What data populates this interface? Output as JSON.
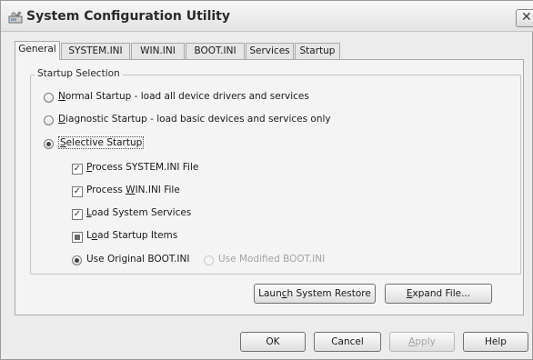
{
  "window": {
    "title": "System Configuration Utility",
    "app_icon": "system-config-icon",
    "close_glyph": "✕"
  },
  "tabs": [
    {
      "label": "General",
      "active": true
    },
    {
      "label": "SYSTEM.INI",
      "active": false
    },
    {
      "label": "WIN.INI",
      "active": false
    },
    {
      "label": "BOOT.INI",
      "active": false
    },
    {
      "label": "Services",
      "active": false
    },
    {
      "label": "Startup",
      "active": false
    }
  ],
  "startup_selection": {
    "group_label": "Startup Selection",
    "normal": {
      "prefix": "",
      "mnemonic": "N",
      "rest": "ormal Startup - load all device drivers and services",
      "checked": false
    },
    "diagnostic": {
      "prefix": "",
      "mnemonic": "D",
      "rest": "iagnostic Startup - load basic devices and services only",
      "checked": false
    },
    "selective": {
      "prefix": "",
      "mnemonic": "S",
      "rest": "elective Startup",
      "checked": true
    },
    "options": {
      "process_system_ini": {
        "prefix": "",
        "mnemonic": "P",
        "rest": "rocess SYSTEM.INI File",
        "state": "checked"
      },
      "process_win_ini": {
        "prefix": "Process ",
        "mnemonic": "W",
        "rest": "IN.INI File",
        "state": "checked"
      },
      "load_system_services": {
        "prefix": "",
        "mnemonic": "L",
        "rest": "oad System Services",
        "state": "checked"
      },
      "load_startup_items": {
        "prefix": "L",
        "mnemonic": "o",
        "rest": "ad Startup Items",
        "state": "partial"
      }
    },
    "boot": {
      "original": {
        "label": "Use Original BOOT.INI",
        "checked": true
      },
      "modified": {
        "label": "Use Modified BOOT.INI",
        "checked": false,
        "disabled": true
      }
    }
  },
  "panel_buttons": {
    "restore": {
      "prefix": "Laun",
      "mnemonic": "c",
      "rest": "h System Restore"
    },
    "expand": {
      "prefix": "",
      "mnemonic": "E",
      "rest": "xpand File..."
    }
  },
  "dialog_buttons": {
    "ok": {
      "label": "OK"
    },
    "cancel": {
      "label": "Cancel"
    },
    "apply": {
      "prefix": "",
      "mnemonic": "A",
      "rest": "pply",
      "disabled": true
    },
    "help": {
      "label": "Help"
    }
  },
  "colors": {
    "window_bg": "#ececec",
    "panel_bg": "#f4f4f4",
    "disabled_text": "#a4a4a4"
  }
}
